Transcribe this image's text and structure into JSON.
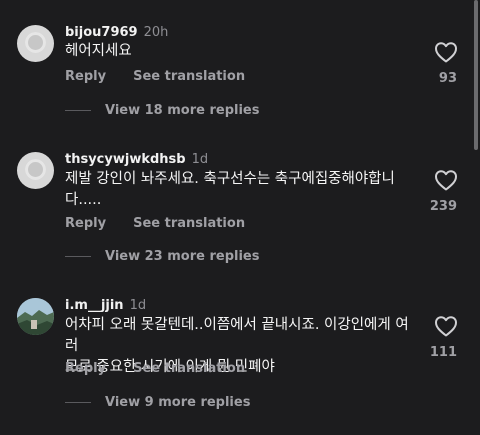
{
  "comments": [
    {
      "username": "bijou7969",
      "time": "20h",
      "text": "헤어지세요",
      "reply_label": "Reply",
      "translate_label": "See translation",
      "likes": "93",
      "view_replies": "View 18 more replies"
    },
    {
      "username": "thsycywjwkdhsb",
      "time": "1d",
      "text": "제발 강인이 놔주세요. 축구선수는 축구에집중해야합니\n다.....",
      "reply_label": "Reply",
      "translate_label": "See translation",
      "likes": "239",
      "view_replies": "View 23 more replies"
    },
    {
      "username": "i.m__jjin",
      "time": "1d",
      "text": "어차피 오래 못갈텐데..이쯤에서 끝내시죠. 이강인에게 여러\n모로 중요한 시기에 이게 뭔 민폐야",
      "reply_label": "Reply",
      "translate_label": "See translation",
      "likes": "111",
      "view_replies": "View 9 more replies"
    }
  ],
  "colors": {
    "background": "#1c1c1e",
    "text_primary": "#f2f2f2",
    "text_secondary": "#a0a0a5"
  },
  "icons": {
    "like": "heart-outline-icon"
  }
}
